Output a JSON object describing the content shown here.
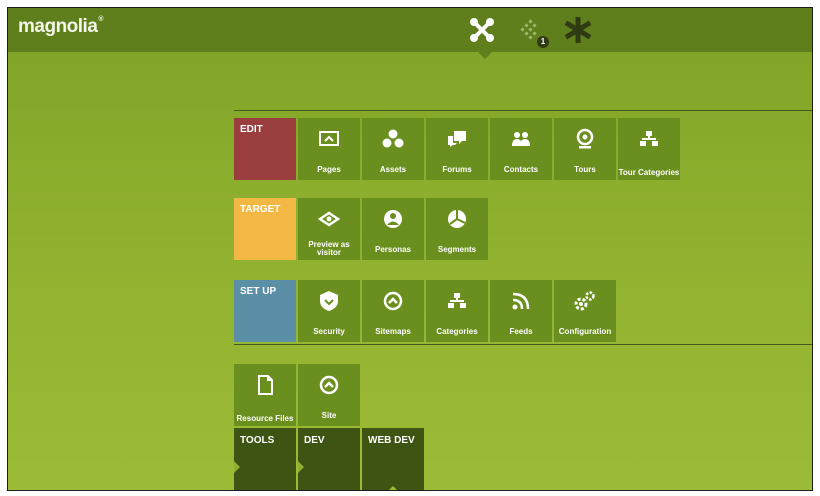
{
  "app": {
    "logo": "magnolia"
  },
  "topbar": {
    "icons": [
      "apps-icon",
      "pulse-icon",
      "favorites-icon"
    ],
    "notification_count": "1"
  },
  "colors": {
    "topbar": "#5f7f1d",
    "tile": "#6a8f1f",
    "edit": "#993d3f",
    "target": "#f2b843",
    "setup": "#5a8fa6",
    "tab": "#3e5413"
  },
  "groups": {
    "edit": {
      "label": "EDIT",
      "items": [
        {
          "label": "Pages",
          "icon": "pages-icon"
        },
        {
          "label": "Assets",
          "icon": "assets-icon"
        },
        {
          "label": "Forums",
          "icon": "forums-icon"
        },
        {
          "label": "Contacts",
          "icon": "contacts-icon"
        },
        {
          "label": "Tours",
          "icon": "tours-icon"
        },
        {
          "label": "Tour Categories",
          "icon": "tour-categories-icon"
        }
      ]
    },
    "target": {
      "label": "TARGET",
      "items": [
        {
          "label": "Preview as visitor",
          "icon": "preview-icon"
        },
        {
          "label": "Personas",
          "icon": "personas-icon"
        },
        {
          "label": "Segments",
          "icon": "segments-icon"
        }
      ]
    },
    "setup": {
      "label": "SET UP",
      "items": [
        {
          "label": "Security",
          "icon": "security-icon"
        },
        {
          "label": "Sitemaps",
          "icon": "sitemaps-icon"
        },
        {
          "label": "Categories",
          "icon": "categories-icon"
        },
        {
          "label": "Feeds",
          "icon": "feeds-icon"
        },
        {
          "label": "Configuration",
          "icon": "configuration-icon"
        }
      ]
    },
    "tools": {
      "items": [
        {
          "label": "Resource Files",
          "icon": "resource-files-icon"
        },
        {
          "label": "Site",
          "icon": "site-icon"
        }
      ]
    }
  },
  "tabs": [
    {
      "label": "TOOLS"
    },
    {
      "label": "DEV"
    },
    {
      "label": "WEB DEV",
      "selected": true
    }
  ]
}
